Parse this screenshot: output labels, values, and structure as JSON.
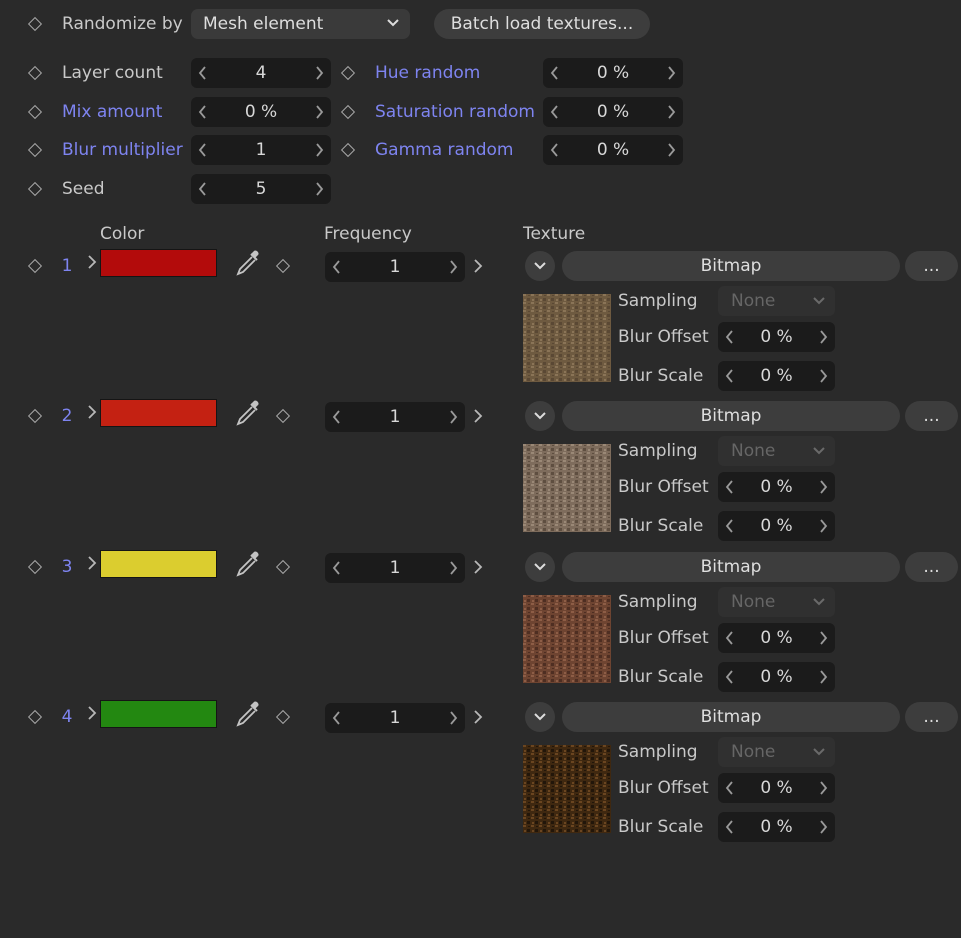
{
  "top": {
    "randomize_label": "Randomize by",
    "randomize_value": "Mesh element",
    "batch_button": "Batch load textures..."
  },
  "params": {
    "layer_count": {
      "label": "Layer count",
      "value": "4"
    },
    "mix_amount": {
      "label": "Mix amount",
      "value": "0 %"
    },
    "blur_multiplier": {
      "label": "Blur multiplier",
      "value": "1"
    },
    "seed": {
      "label": "Seed",
      "value": "5"
    },
    "hue_random": {
      "label": "Hue random",
      "value": "0 %"
    },
    "saturation_random": {
      "label": "Saturation random",
      "value": "0 %"
    },
    "gamma_random": {
      "label": "Gamma random",
      "value": "0 %"
    }
  },
  "headers": {
    "color": "Color",
    "frequency": "Frequency",
    "texture": "Texture"
  },
  "layers": [
    {
      "index": "1",
      "color": "#b30b0b",
      "frequency": "1",
      "texture_type": "Bitmap",
      "more": "...",
      "sampling_label": "Sampling",
      "sampling_value": "None",
      "blur_offset_label": "Blur Offset",
      "blur_offset_value": "0 %",
      "blur_scale_label": "Blur Scale",
      "blur_scale_value": "0 %",
      "thumb_colors": [
        "#6e5a40",
        "#8a7457",
        "#5a4834"
      ]
    },
    {
      "index": "2",
      "color": "#c42112",
      "frequency": "1",
      "texture_type": "Bitmap",
      "more": "...",
      "sampling_label": "Sampling",
      "sampling_value": "None",
      "blur_offset_label": "Blur Offset",
      "blur_offset_value": "0 %",
      "blur_scale_label": "Blur Scale",
      "blur_scale_value": "0 %",
      "thumb_colors": [
        "#7e6c5c",
        "#9a8876",
        "#5e4e40"
      ]
    },
    {
      "index": "3",
      "color": "#dbcd2f",
      "frequency": "1",
      "texture_type": "Bitmap",
      "more": "...",
      "sampling_label": "Sampling",
      "sampling_value": "None",
      "blur_offset_label": "Blur Offset",
      "blur_offset_value": "0 %",
      "blur_scale_label": "Blur Scale",
      "blur_scale_value": "0 %",
      "thumb_colors": [
        "#6e4431",
        "#8d5d46",
        "#4e2e22"
      ]
    },
    {
      "index": "4",
      "color": "#238811",
      "frequency": "1",
      "texture_type": "Bitmap",
      "more": "...",
      "sampling_label": "Sampling",
      "sampling_value": "None",
      "blur_offset_label": "Blur Offset",
      "blur_offset_value": "0 %",
      "blur_scale_label": "Blur Scale",
      "blur_scale_value": "0 %",
      "thumb_colors": [
        "#3f2810",
        "#6a4520",
        "#22160a"
      ]
    }
  ]
}
